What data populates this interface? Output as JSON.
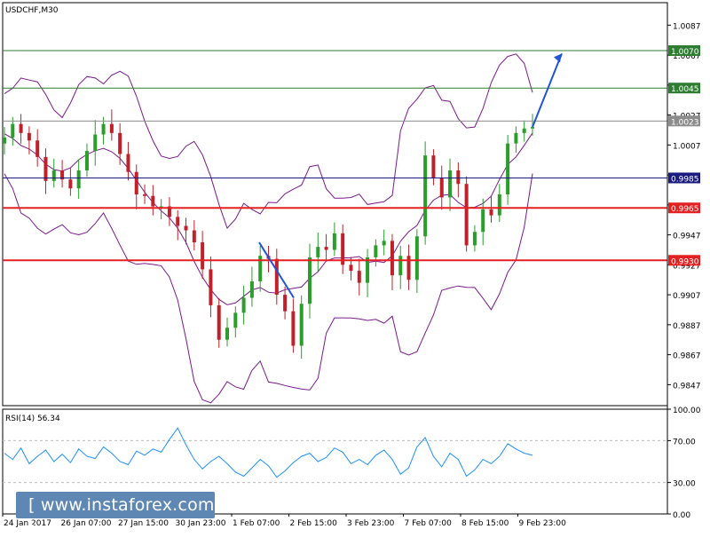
{
  "chart_data": [
    {
      "type": "line",
      "title": "USDCHF,M30",
      "subtype": "candlestick with Bollinger Bands",
      "y_ticks": [
        "1.0087",
        "1.0067",
        "1.0047",
        "1.0027",
        "1.0007",
        "0.9987",
        "0.9967",
        "0.9947",
        "0.9927",
        "0.9907",
        "0.9887",
        "0.9867",
        "0.9847"
      ],
      "x_ticks": [
        "24 Jan 2017",
        "26 Jan 07:00",
        "27 Jan 15:00",
        "30 Jan 23:00",
        "1 Feb 07:00",
        "2 Feb 15:00",
        "3 Feb 23:00",
        "7 Feb 07:00",
        "8 Feb 15:00",
        "9 Feb 23:00"
      ],
      "ylim": [
        0.9833,
        1.0102
      ],
      "series": [
        {
          "values": [
            1.0012,
            1.0021,
            1.0015,
            1.001,
            0.9999,
            0.9983,
            0.999,
            0.9984,
            0.9978,
            0.999,
            1.0003,
            1.0014,
            1.0021,
            1.0015,
            1.0001,
            0.9989,
            0.9974,
            0.9973,
            0.9966,
            0.9966,
            0.9959,
            0.9953,
            0.995,
            0.9942,
            0.9924,
            0.99,
            0.9877,
            0.9885,
            0.9895,
            0.9905,
            0.9916,
            0.9933,
            0.9931,
            0.9907,
            0.9896,
            0.9873,
            0.9901,
            0.9932,
            0.9939,
            0.9937,
            0.9948,
            0.9927,
            0.9923,
            0.9915,
            0.9932,
            0.994,
            0.9943,
            0.992,
            0.9933,
            0.9917,
            0.9946,
            1.0,
            0.9985,
            0.9972,
            0.999,
            0.9981,
            0.994,
            0.9949,
            0.9964,
            0.996,
            0.9974,
            1.0008,
            1.0015,
            1.0018,
            1.0019
          ]
        }
      ],
      "levels": [
        {
          "label": "1.0070",
          "value": 1.007,
          "color": "#2e7d32"
        },
        {
          "label": "1.0045",
          "value": 1.0045,
          "color": "#2e7d32"
        },
        {
          "label": "1.0023",
          "value": 1.0023,
          "color": "#8c8c8c"
        },
        {
          "label": "0.9985",
          "value": 0.9985,
          "color": "#1a1a80"
        },
        {
          "label": "0.9965",
          "value": 0.9965,
          "color": "#e52020"
        },
        {
          "label": "0.9930",
          "value": 0.993,
          "color": "#e52020"
        }
      ],
      "colors": {
        "up": "#2a9d2a",
        "down": "#c0202a",
        "bands": "#7a1a8c",
        "arrow": "#1f55d6"
      }
    },
    {
      "type": "line",
      "title": "RSI(14) 56.34",
      "y_ticks": [
        "100.00",
        "70.00",
        "30.00",
        "0.00"
      ],
      "ylim": [
        0,
        100
      ],
      "levels": [
        70,
        30
      ],
      "series": [
        {
          "color": "#1e90ff",
          "values": [
            58,
            52,
            63,
            48,
            55,
            61,
            50,
            57,
            49,
            62,
            55,
            53,
            64,
            58,
            50,
            47,
            60,
            56,
            62,
            59,
            71,
            82,
            66,
            52,
            43,
            50,
            55,
            48,
            40,
            36,
            44,
            52,
            46,
            35,
            41,
            49,
            55,
            58,
            50,
            54,
            63,
            59,
            48,
            52,
            47,
            56,
            61,
            52,
            38,
            44,
            64,
            73,
            55,
            45,
            58,
            52,
            36,
            42,
            52,
            48,
            55,
            67,
            62,
            58,
            56
          ]
        }
      ]
    }
  ]
}
